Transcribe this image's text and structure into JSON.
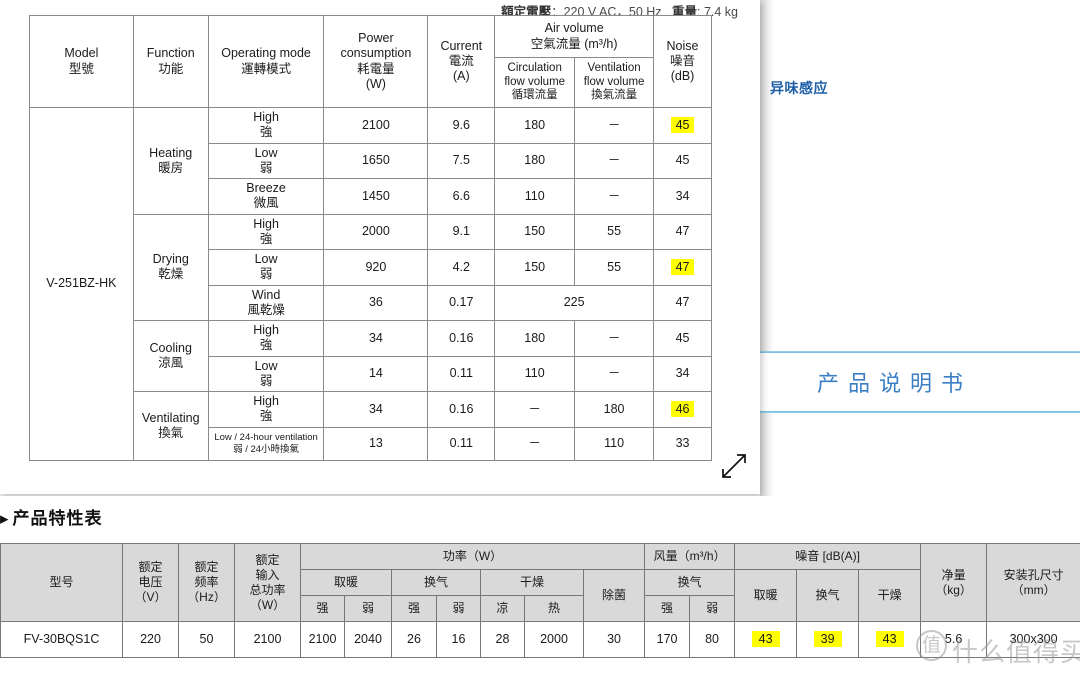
{
  "background": {
    "odor_label": "异味感应",
    "manual_box_label": "产品说明书"
  },
  "overlay": {
    "spec_note_prefix": "額定電壓",
    "spec_note_value": "：220 V AC，50 Hz",
    "weight_label": "重量",
    "weight_value": ": 7.4 kg",
    "resize_icon": "resize-diagonal-icon"
  },
  "spec_table": {
    "headers": {
      "model": "Model\n型號",
      "model_en": "Model",
      "model_zh": "型號",
      "function_en": "Function",
      "function_zh": "功能",
      "operating_mode_en": "Operating mode",
      "operating_mode_zh": "運轉模式",
      "power_en": "Power",
      "power_en2": "consumption",
      "power_zh": "耗電量",
      "power_unit": "(W)",
      "current_en": "Current",
      "current_zh": "電流",
      "current_unit": "(A)",
      "air_volume_en": "Air volume",
      "air_volume_zh": "空氣流量 (m³/h)",
      "circulation_en1": "Circulation",
      "circulation_en2": "flow volume",
      "circulation_zh": "循環流量",
      "ventilation_en1": "Ventilation",
      "ventilation_en2": "flow volume",
      "ventilation_zh": "換氣流量",
      "noise_en": "Noise",
      "noise_zh": "噪音",
      "noise_unit": "(dB)"
    },
    "model": "V-251BZ-HK",
    "groups": [
      {
        "function_en": "Heating",
        "function_zh": "暖房",
        "rows": [
          {
            "mode_en": "High",
            "mode_zh": "強",
            "power": "2100",
            "current": "9.6",
            "circulation": "180",
            "ventilation": "－",
            "noise": "45",
            "noise_highlight": true
          },
          {
            "mode_en": "Low",
            "mode_zh": "弱",
            "power": "1650",
            "current": "7.5",
            "circulation": "180",
            "ventilation": "－",
            "noise": "45",
            "noise_highlight": false
          },
          {
            "mode_en": "Breeze",
            "mode_zh": "微風",
            "power": "1450",
            "current": "6.6",
            "circulation": "110",
            "ventilation": "－",
            "noise": "34",
            "noise_highlight": false
          }
        ]
      },
      {
        "function_en": "Drying",
        "function_zh": "乾燥",
        "rows": [
          {
            "mode_en": "High",
            "mode_zh": "強",
            "power": "2000",
            "current": "9.1",
            "circulation": "150",
            "ventilation": "55",
            "noise": "47",
            "noise_highlight": false
          },
          {
            "mode_en": "Low",
            "mode_zh": "弱",
            "power": "920",
            "current": "4.2",
            "circulation": "150",
            "ventilation": "55",
            "noise": "47",
            "noise_highlight": true
          },
          {
            "mode_en": "Wind",
            "mode_zh": "風乾燥",
            "power": "36",
            "current": "0.17",
            "merged_air": "225",
            "noise": "47",
            "noise_highlight": false
          }
        ]
      },
      {
        "function_en": "Cooling",
        "function_zh": "涼風",
        "rows": [
          {
            "mode_en": "High",
            "mode_zh": "強",
            "power": "34",
            "current": "0.16",
            "circulation": "180",
            "ventilation": "－",
            "noise": "45",
            "noise_highlight": false
          },
          {
            "mode_en": "Low",
            "mode_zh": "弱",
            "power": "14",
            "current": "0.11",
            "circulation": "110",
            "ventilation": "－",
            "noise": "34",
            "noise_highlight": false
          }
        ]
      },
      {
        "function_en": "Ventilating",
        "function_zh": "換氣",
        "rows": [
          {
            "mode_en": "High",
            "mode_zh": "強",
            "power": "34",
            "current": "0.16",
            "circulation": "－",
            "ventilation": "180",
            "noise": "46",
            "noise_highlight": true
          },
          {
            "mode_en": "Low / 24-hour ventilation",
            "mode_zh": "弱 / 24小時換氣",
            "small": true,
            "power": "13",
            "current": "0.11",
            "circulation": "－",
            "ventilation": "110",
            "noise": "33",
            "noise_highlight": false
          }
        ]
      }
    ]
  },
  "feature_section": {
    "title": "产品特性表",
    "bullet": "▸",
    "headers": {
      "model": "型号",
      "rated_voltage": "额定\n电压\n（V）",
      "rated_voltage_l1": "额定",
      "rated_voltage_l2": "电压",
      "rated_voltage_l3": "（V）",
      "rated_freq_l1": "额定",
      "rated_freq_l2": "频率",
      "rated_freq_l3": "（Hz）",
      "rated_input_l1": "额定",
      "rated_input_l2": "输入",
      "rated_input_l3": "总功率",
      "rated_input_l4": "（W）",
      "power_group": "功率（W）",
      "airflow_group": "风量（m³/h）",
      "noise_group": "噪音 [dB(A)]",
      "heating": "取暖",
      "ventilating": "换气",
      "drying": "干燥",
      "sterilize": "除菌",
      "strong": "强",
      "weak": "弱",
      "cool": "凉",
      "hot": "热",
      "net_weight_l1": "净量",
      "net_weight_l2": "（kg）",
      "hole_size_l1": "安装孔尺寸",
      "hole_size_l2": "（mm）"
    },
    "row": {
      "model": "FV-30BQS1C",
      "rated_voltage": "220",
      "rated_freq": "50",
      "rated_input": "2100",
      "power_heating_strong": "2100",
      "power_heating_weak": "2040",
      "power_vent_strong": "26",
      "power_vent_weak": "16",
      "power_dry_cool": "28",
      "power_dry_hot": "2000",
      "power_sterilize": "30",
      "airflow_vent_strong": "170",
      "airflow_vent_weak": "80",
      "noise_heating": "43",
      "noise_vent": "39",
      "noise_dry": "43",
      "net_weight": "5.6",
      "hole_size": "300x300"
    },
    "highlights": [
      "noise_heating",
      "noise_vent",
      "noise_dry"
    ]
  },
  "watermark": {
    "mark": "值",
    "text": "什么值得买"
  },
  "colors": {
    "highlight": "#ffff00",
    "accent_blue": "#3b7fc4",
    "label_blue": "#1f5fa8",
    "table_header_gray": "#d9d9d9",
    "page_gray": "#f2f3f5"
  }
}
